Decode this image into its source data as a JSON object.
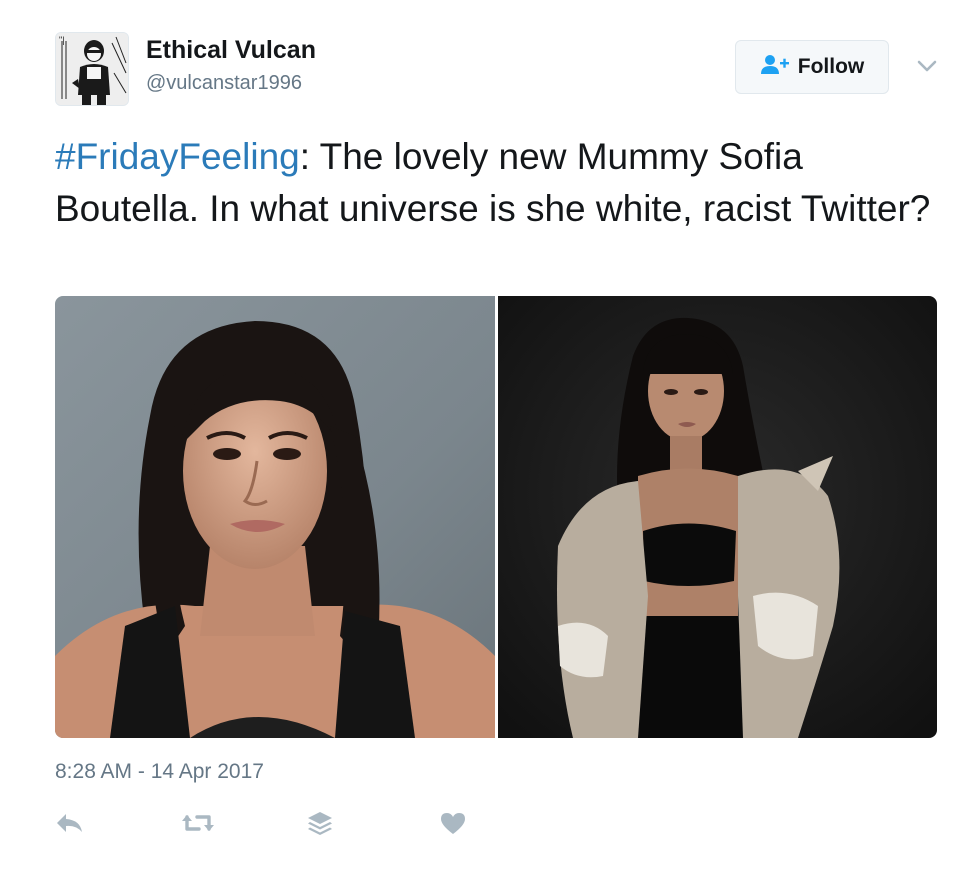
{
  "user": {
    "display_name": "Ethical Vulcan",
    "handle": "@vulcanstar1996"
  },
  "follow_button": {
    "label": "Follow",
    "icon": "user-add-icon"
  },
  "menu": {
    "icon": "chevron-down-icon"
  },
  "tweet": {
    "hashtag": "#FridayFeeling",
    "body": ": The lovely new Mummy Sofia Boutella. In what universe is she white, racist Twitter?",
    "timestamp": "8:28 AM - 14 Apr 2017"
  },
  "media": {
    "photos": [
      {
        "name": "portrait-photo-left"
      },
      {
        "name": "fashion-photo-right"
      }
    ]
  },
  "actions": [
    {
      "name": "reply",
      "icon": "reply-icon"
    },
    {
      "name": "retweet",
      "icon": "retweet-icon"
    },
    {
      "name": "buffer",
      "icon": "layers-icon"
    },
    {
      "name": "like",
      "icon": "heart-icon"
    }
  ],
  "colors": {
    "hashtag": "#2b7bb9",
    "secondary_text": "#657786",
    "action_icon": "#aab8c2",
    "follow_icon": "#1da1f2"
  }
}
